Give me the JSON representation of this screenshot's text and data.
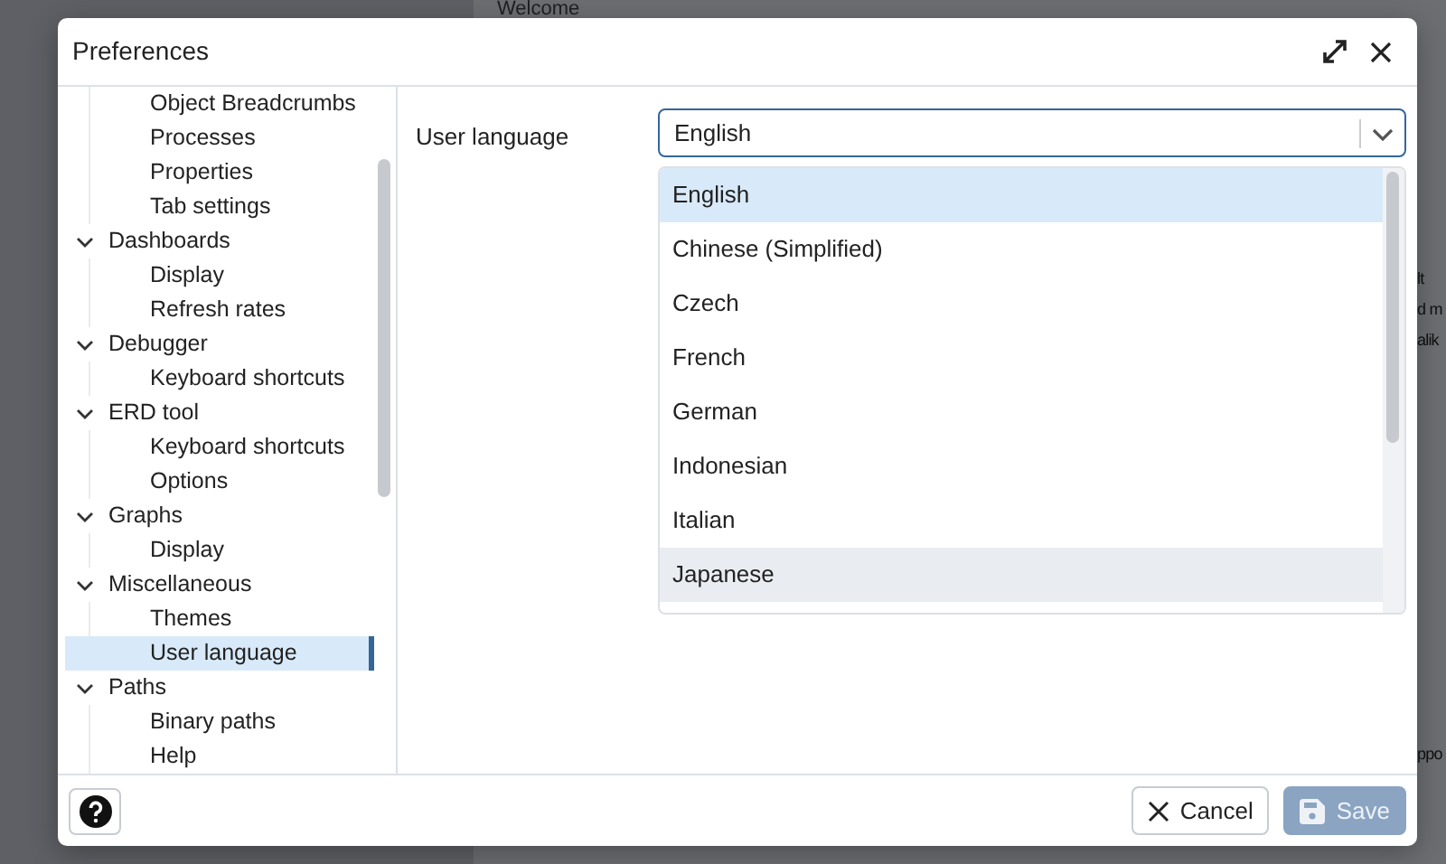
{
  "background": {
    "title": "Welcome",
    "fragments": [
      "lt",
      "d m",
      "alik",
      "ppo"
    ]
  },
  "dialog": {
    "title": "Preferences",
    "tree": [
      {
        "children": [
          {
            "label": "Object Breadcrumbs",
            "selected": false
          },
          {
            "label": "Processes",
            "selected": false
          },
          {
            "label": "Properties",
            "selected": false
          },
          {
            "label": "Tab settings",
            "selected": false
          }
        ]
      },
      {
        "label": "Dashboards",
        "expanded": true,
        "children": [
          {
            "label": "Display",
            "selected": false
          },
          {
            "label": "Refresh rates",
            "selected": false
          }
        ]
      },
      {
        "label": "Debugger",
        "expanded": true,
        "children": [
          {
            "label": "Keyboard shortcuts",
            "selected": false
          }
        ]
      },
      {
        "label": "ERD tool",
        "expanded": true,
        "children": [
          {
            "label": "Keyboard shortcuts",
            "selected": false
          },
          {
            "label": "Options",
            "selected": false
          }
        ]
      },
      {
        "label": "Graphs",
        "expanded": true,
        "children": [
          {
            "label": "Display",
            "selected": false
          }
        ]
      },
      {
        "label": "Miscellaneous",
        "expanded": true,
        "children": [
          {
            "label": "Themes",
            "selected": false
          },
          {
            "label": "User language",
            "selected": true
          }
        ]
      },
      {
        "label": "Paths",
        "expanded": true,
        "children": [
          {
            "label": "Binary paths",
            "selected": false
          },
          {
            "label": "Help",
            "selected": false
          }
        ]
      }
    ],
    "field": {
      "label": "User language",
      "value": "English",
      "expanded": true
    },
    "options": [
      {
        "label": "English",
        "selected": true,
        "hovered": false
      },
      {
        "label": "Chinese (Simplified)",
        "selected": false,
        "hovered": false
      },
      {
        "label": "Czech",
        "selected": false,
        "hovered": false
      },
      {
        "label": "French",
        "selected": false,
        "hovered": false
      },
      {
        "label": "German",
        "selected": false,
        "hovered": false
      },
      {
        "label": "Indonesian",
        "selected": false,
        "hovered": false
      },
      {
        "label": "Italian",
        "selected": false,
        "hovered": false
      },
      {
        "label": "Japanese",
        "selected": false,
        "hovered": true
      }
    ],
    "buttons": [
      {
        "kind": "cancel",
        "label": "Cancel",
        "disabled": false
      },
      {
        "kind": "save",
        "label": "Save",
        "disabled": true
      }
    ]
  }
}
